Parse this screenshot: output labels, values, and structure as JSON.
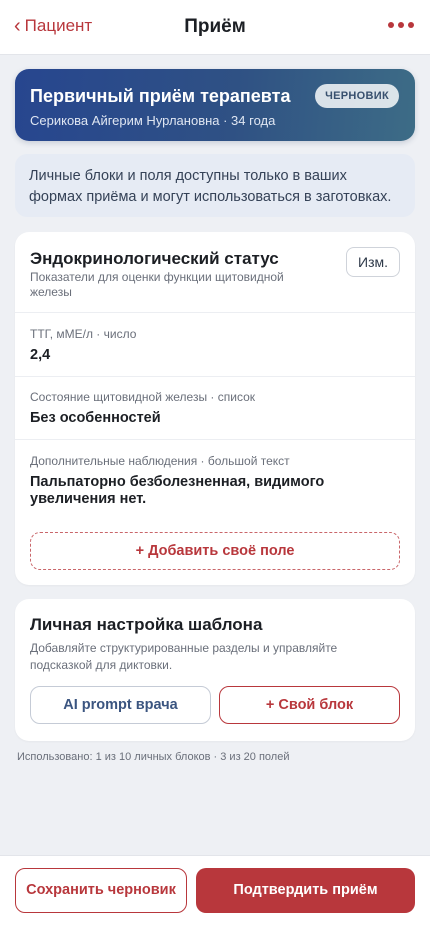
{
  "nav": {
    "back_chevron": "‹",
    "back_label": "Пациент",
    "title": "Приём",
    "more_icon": "more-horizontal-icon"
  },
  "hero": {
    "title": "Первичный приём терапевта",
    "subtitle": "Серикова Айгерим Нурлановна · 34 года",
    "badge": "ЧЕРНОВИК"
  },
  "note": {
    "text": "Личные блоки и поля доступны только в ваших формах приёма и могут использоваться в заготовках."
  },
  "section": {
    "title": "Эндокринологический статус",
    "description": "Показатели для оценки функции щитовидной железы",
    "edit_label": "Изм.",
    "fields": [
      {
        "label": "ТТГ, мМЕ/л · число",
        "value": "2,4"
      },
      {
        "label": "Состояние щитовидной железы · список",
        "value": "Без особенностей"
      },
      {
        "label": "Дополнительные наблюдения · большой текст",
        "value": "Пальпаторно безболезненная, видимого увеличения нет."
      }
    ],
    "add_field_label": "+ Добавить своё поле"
  },
  "template": {
    "title": "Личная настройка шаблона",
    "description": "Добавляйте структурированные разделы и управляйте подсказкой для диктовки.",
    "ai_prompt_label": "AI prompt врача",
    "own_block_label": "+ Свой блок"
  },
  "usage": "Использовано: 1 из 10 личных блоков · 3 из 20 полей",
  "footer": {
    "save_draft_label": "Сохранить черновик",
    "confirm_label": "Подтвердить приём"
  },
  "colors": {
    "accent": "#b8373c",
    "hero_gradient_start": "#27468f",
    "hero_gradient_end": "#3d6c86",
    "background": "#eef0f4"
  }
}
